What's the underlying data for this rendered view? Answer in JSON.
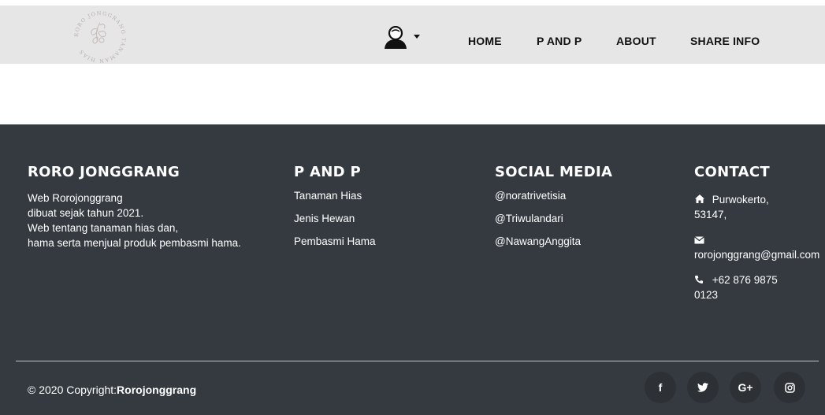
{
  "header": {
    "logo_text": "RORO JONGGRANG TANAMAN HIAS",
    "nav": [
      {
        "label": "HOME"
      },
      {
        "label": "P AND P"
      },
      {
        "label": "ABOUT"
      },
      {
        "label": "SHARE INFO"
      }
    ],
    "user_icon": "user-avatar-icon"
  },
  "footer": {
    "about": {
      "title": "RORO JONGGRANG",
      "lines": [
        "Web Rorojonggrang",
        "dibuat sejak tahun 2021.",
        "Web tentang tanaman hias dan,",
        "hama serta menjual produk pembasmi hama."
      ]
    },
    "pandp": {
      "title": "P AND P",
      "links": [
        "Tanaman Hias",
        "Jenis Hewan",
        "Pembasmi Hama"
      ]
    },
    "social": {
      "title": "SOCIAL MEDIA",
      "links": [
        "@noratrivetisia",
        "@Triwulandari",
        "@NawangAnggita"
      ]
    },
    "contact": {
      "title": "CONTACT",
      "address_1": "Purwokerto,",
      "address_2": "53147,",
      "email": "rorojonggrang@gmail.com",
      "phone_1": "+62 876 9875",
      "phone_2": "0123"
    },
    "copyright_prefix": "© 2020 Copyright:",
    "copyright_brand": "Rorojonggrang",
    "social_buttons": [
      {
        "icon": "facebook-icon",
        "glyph": "f"
      },
      {
        "icon": "twitter-icon",
        "glyph": ""
      },
      {
        "icon": "google-plus-icon",
        "glyph": "G+"
      },
      {
        "icon": "instagram-icon",
        "glyph": ""
      }
    ],
    "colors": {
      "background": "#343a40",
      "button": "#2d3135",
      "navbar": "#e6e6e6"
    }
  }
}
